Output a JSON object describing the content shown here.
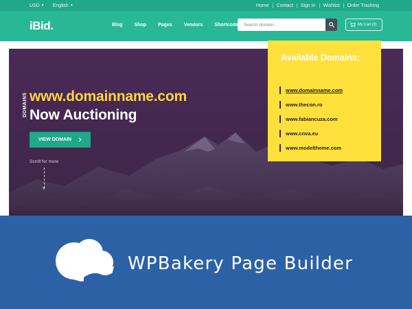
{
  "topbar": {
    "currency": "USD",
    "language": "English",
    "links": [
      "Home",
      "Contact",
      "Sign In",
      "Wishlist",
      "Order Tracking"
    ]
  },
  "header": {
    "logo": "iBid.",
    "nav": [
      "Blog",
      "Shop",
      "Pages",
      "Vendors",
      "Shortcodes"
    ],
    "search_placeholder": "Search domain...",
    "cart_label": "My Cart (0)"
  },
  "hero": {
    "vertical_label": "DOMAINS",
    "line1": "www.domainname.com",
    "line2": "Now Auctioning",
    "button_label": "VIEW DOMAIN",
    "scroll_label": "Scroll for more"
  },
  "domains_panel": {
    "title": "Available Domains:",
    "items": [
      "www.domainname.com",
      "www.thecon.ro",
      "www.fabiancuza.com",
      "www.cnva.eu",
      "www.modeltheme.com"
    ]
  },
  "banner": {
    "text": "WPBakery Page Builder"
  },
  "colors": {
    "topbar": "#1fa889",
    "header": "#29b896",
    "hero_bg": "#44284f",
    "accent_yellow": "#ffd541",
    "panel_yellow": "#ffe03d",
    "banner_blue": "#2c61a5"
  },
  "icons": {
    "search": "search-icon",
    "cart": "cart-icon",
    "button_arrow": "chevron-right-icon",
    "brand": "wpbakery-cloud-logo"
  }
}
